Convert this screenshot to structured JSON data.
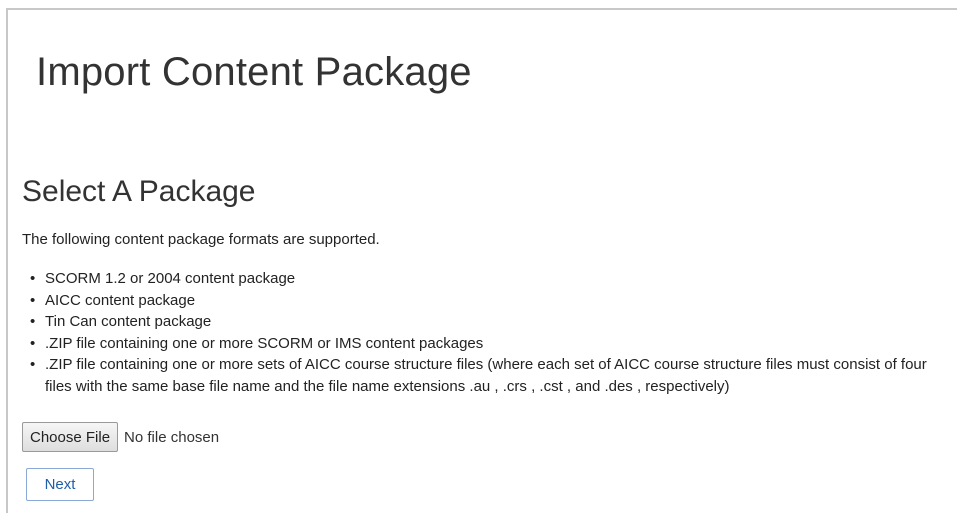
{
  "header": {
    "title": "Import Content Package"
  },
  "section": {
    "title": "Select A Package",
    "intro": "The following content package formats are supported.",
    "formats": [
      "SCORM 1.2 or 2004 content package",
      "AICC content package",
      "Tin Can content package",
      ".ZIP file containing one or more SCORM or IMS content packages",
      ".ZIP file containing one or more sets of AICC course structure files (where each set of AICC course structure files must consist of four files with the same base file name and the file name extensions .au , .crs , .cst , and .des , respectively)"
    ]
  },
  "file_input": {
    "button_label": "Choose File",
    "status": "No file chosen"
  },
  "actions": {
    "next_label": "Next"
  },
  "colors": {
    "link_blue": "#1f5fa8",
    "border_gray": "#c8c8c8"
  }
}
